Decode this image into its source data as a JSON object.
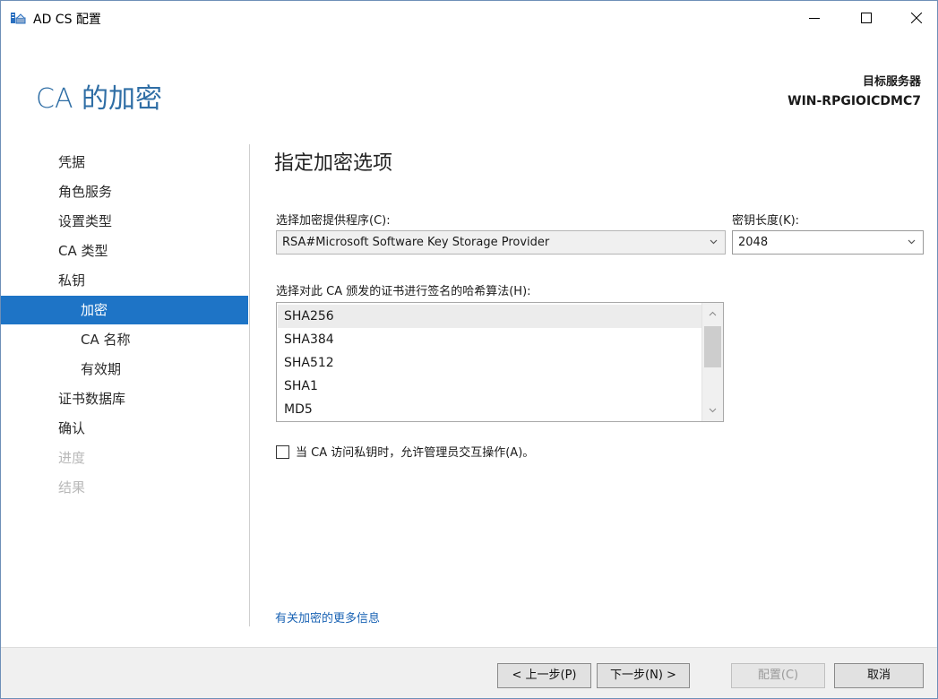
{
  "window": {
    "title": "AD CS 配置",
    "app_icon": "server-config-icon",
    "controls": [
      "minimize-icon",
      "maximize-icon",
      "close-icon"
    ]
  },
  "header": {
    "page_title": "CA 的加密",
    "target_server_label": "目标服务器",
    "target_server_name": "WIN-RPGIOICDMC7"
  },
  "nav": {
    "items": [
      {
        "label": "凭据",
        "state": "normal"
      },
      {
        "label": "角色服务",
        "state": "normal"
      },
      {
        "label": "设置类型",
        "state": "normal"
      },
      {
        "label": "CA 类型",
        "state": "normal"
      },
      {
        "label": "私钥",
        "state": "normal"
      },
      {
        "label": "加密",
        "state": "active"
      },
      {
        "label": "CA 名称",
        "state": "normal"
      },
      {
        "label": "有效期",
        "state": "normal"
      },
      {
        "label": "证书数据库",
        "state": "normal"
      },
      {
        "label": "确认",
        "state": "normal"
      },
      {
        "label": "进度",
        "state": "disabled"
      },
      {
        "label": "结果",
        "state": "disabled"
      }
    ]
  },
  "main": {
    "section_title": "指定加密选项",
    "provider_label": "选择加密提供程序(C):",
    "provider_value": "RSA#Microsoft Software Key Storage Provider",
    "key_length_label": "密钥长度(K):",
    "key_length_value": "2048",
    "hash_label": "选择对此 CA 颁发的证书进行签名的哈希算法(H):",
    "hash_options": [
      "SHA256",
      "SHA384",
      "SHA512",
      "SHA1",
      "MD5"
    ],
    "hash_selected": "SHA256",
    "allow_interaction_label": "当 CA 访问私钥时，允许管理员交互操作(A)。",
    "allow_interaction_checked": false,
    "more_info_link": "有关加密的更多信息"
  },
  "footer": {
    "prev": "< 上一步(P)",
    "next": "下一步(N) >",
    "configure": "配置(C)",
    "cancel": "取消"
  },
  "colors": {
    "accent": "#1e74c6",
    "title_blue": "#2f6ea5",
    "link": "#1a63b4",
    "disabled_text": "#b8b8b8"
  }
}
